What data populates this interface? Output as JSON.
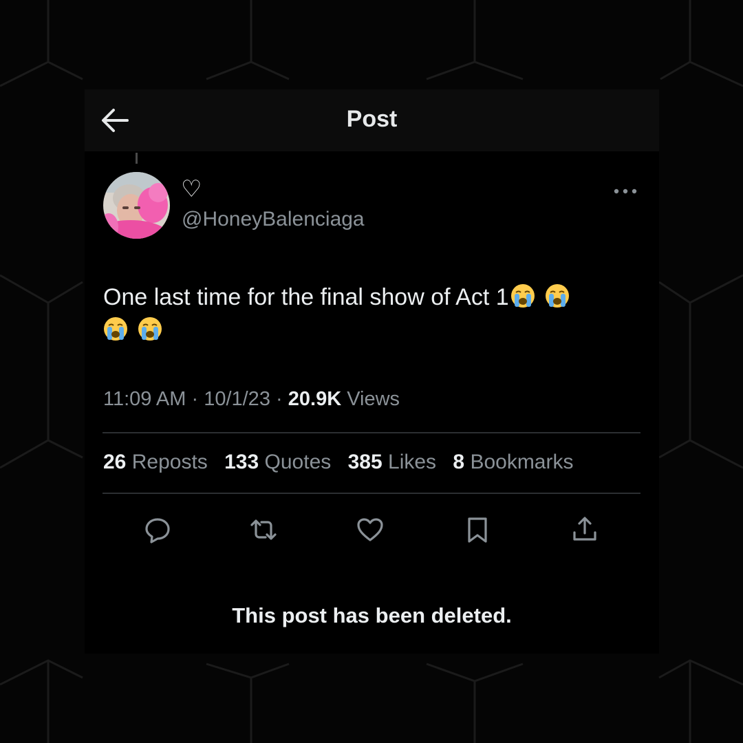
{
  "header": {
    "title": "Post"
  },
  "post": {
    "author_name_glyph": "♡",
    "handle": "@HoneyBalenciaga",
    "text_main": "One last time for the final show of Act 1",
    "time": "11:09 AM",
    "date": "10/1/23",
    "views_count": "20.9K",
    "views_label": "Views",
    "separator": "·"
  },
  "stats": {
    "reposts": {
      "count": "26",
      "label": "Reposts"
    },
    "quotes": {
      "count": "133",
      "label": "Quotes"
    },
    "likes": {
      "count": "385",
      "label": "Likes"
    },
    "bookmarks": {
      "count": "8",
      "label": "Bookmarks"
    }
  },
  "actions": [
    "reply-icon",
    "repost-icon",
    "like-icon",
    "bookmark-icon",
    "share-icon"
  ],
  "notice": "This post has been deleted.",
  "colors": {
    "background": "#050505",
    "card": "#000000",
    "text": "#e7e9ea",
    "muted": "#8b9298",
    "divider": "#2c2f32"
  }
}
